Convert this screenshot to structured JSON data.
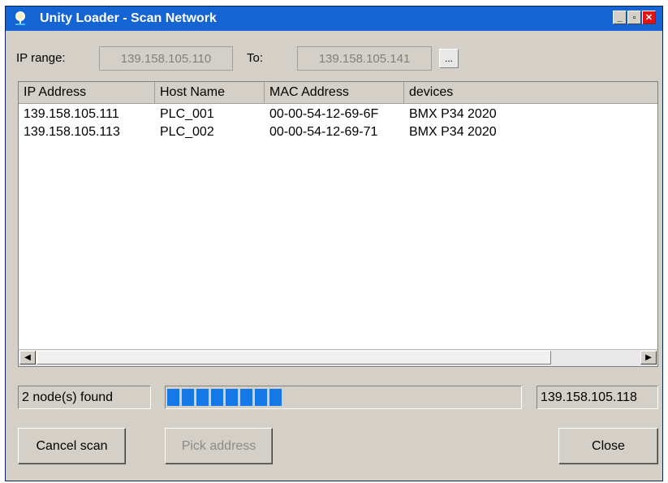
{
  "window": {
    "title": "Unity Loader - Scan Network",
    "controls": {
      "minimize": "_",
      "maximize": "▫",
      "close": "✕"
    }
  },
  "range": {
    "ip_label": "IP range:",
    "from_value": "139.158.105.110",
    "to_label": "To:",
    "to_value": "139.158.105.141",
    "browse_label": "..."
  },
  "table": {
    "columns": [
      "IP Address",
      "Host Name",
      "MAC Address",
      "devices"
    ],
    "rows": [
      [
        "139.158.105.111",
        "PLC_001",
        "00-00-54-12-69-6F",
        "BMX P34 2020"
      ],
      [
        "139.158.105.113",
        "PLC_002",
        "00-00-54-12-69-71",
        "BMX P34 2020"
      ]
    ]
  },
  "status": {
    "nodes_found": "2 node(s) found",
    "current_ip": "139.158.105.118",
    "progress_fraction": 0.33
  },
  "buttons": {
    "cancel": "Cancel scan",
    "pick": "Pick address",
    "close": "Close"
  },
  "colors": {
    "titlebar": "#1464d4",
    "progress": "#1478e6",
    "close_button": "#e81010"
  },
  "icons": [
    "network-icon",
    "minimize-icon",
    "maximize-icon",
    "close-icon",
    "arrow-left-icon",
    "arrow-right-icon"
  ]
}
